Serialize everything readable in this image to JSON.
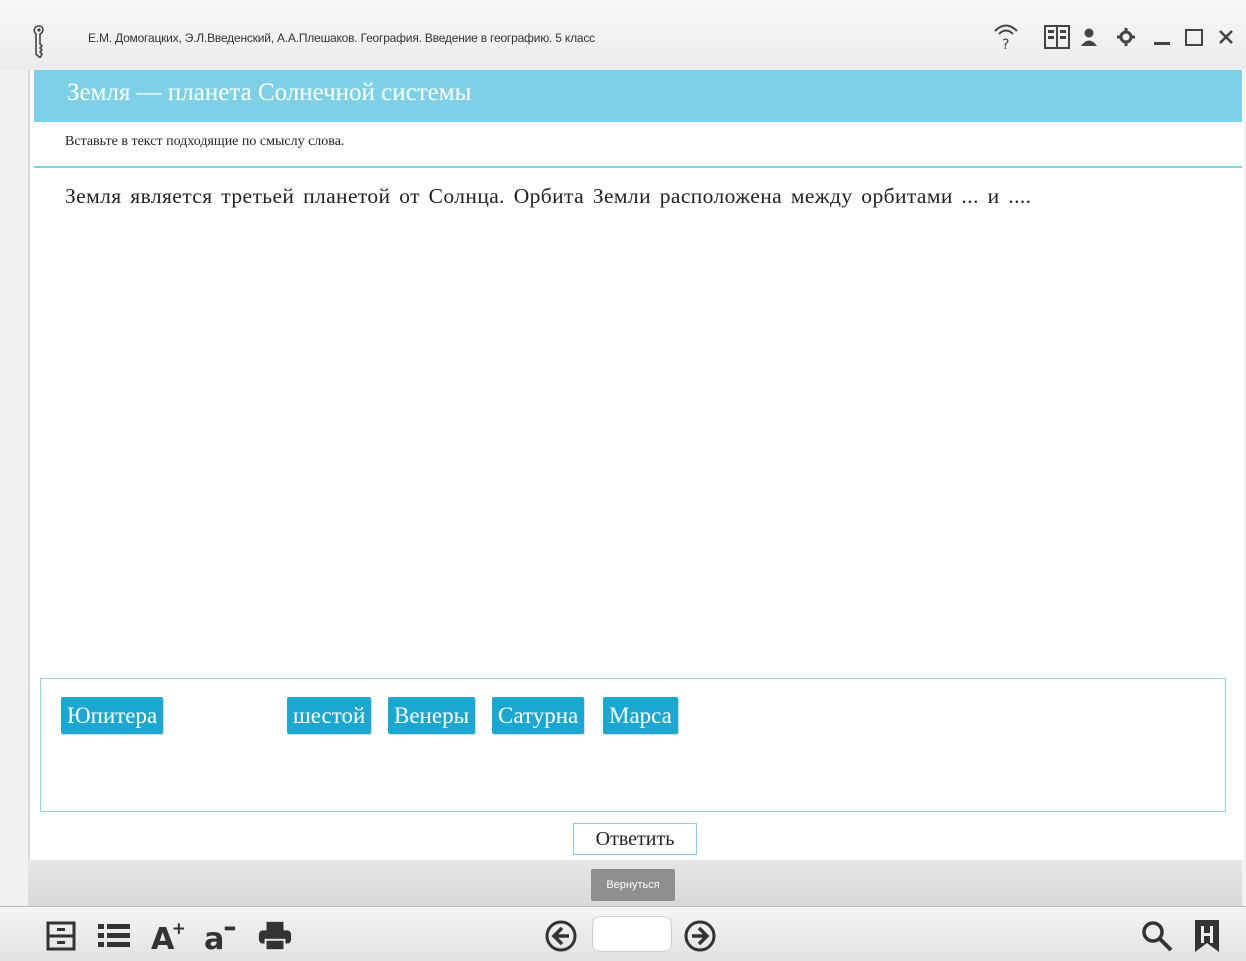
{
  "window": {
    "title": "Е.М. Домогацких, Э.Л.Введенский, А.А.Плешаков. География. Введение в географию. 5 класс"
  },
  "titlebar_icons": [
    "logo-key-icon",
    "help-icon",
    "book-layout-icon",
    "user-icon",
    "settings-icon",
    "minimize-icon",
    "maximize-icon",
    "close-icon"
  ],
  "lesson": {
    "title": "Земля — планета Солнечной системы",
    "instruction": "Вставьте в текст подходящие по смыслу слова.",
    "text": "Земля является третьей планетой от Солнца. Орбита Земли расположена между орбитами ... и ...."
  },
  "word_bank": {
    "words": [
      "Юпитера",
      "шестой",
      "Венеры",
      "Сатурна",
      "Марса"
    ]
  },
  "buttons": {
    "answer": "Ответить",
    "return": "Вернуться"
  },
  "toolbar_icons": [
    "contents-icon",
    "list-icon",
    "font-increase-icon",
    "font-decrease-icon",
    "print-icon",
    "prev-page-icon",
    "next-page-icon",
    "search-icon",
    "bookmark-icon"
  ],
  "pager": {
    "page": ""
  },
  "colors": {
    "accent": "#7ed0e6",
    "chip": "#1ba7cf",
    "return": "#8f8f8f"
  }
}
